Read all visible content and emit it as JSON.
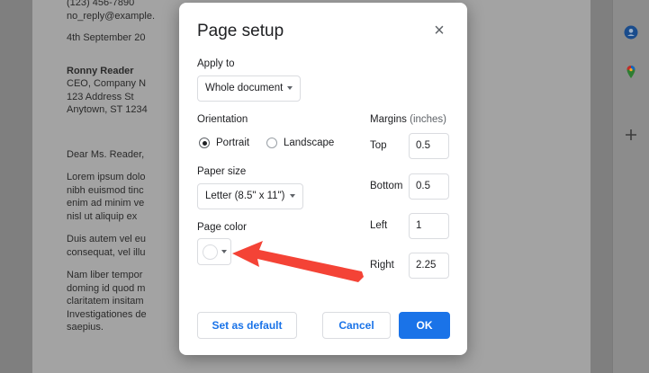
{
  "document": {
    "lines_top": [
      "(123) 456-7890",
      "no_reply@example."
    ],
    "date": "4th September 20",
    "recipient": [
      "Ronny Reader",
      "CEO, Company N",
      "123 Address St",
      "Anytown, ST 1234"
    ],
    "greeting": "Dear Ms. Reader,",
    "para1": [
      "Lorem ipsum dolo",
      "nibh euismod tinc",
      "enim ad minim ve",
      "nisl ut aliquip ex"
    ],
    "para2": [
      "Duis autem vel eu",
      "consequat, vel illu"
    ],
    "para3": [
      "Nam liber tempor",
      "doming id quod m",
      "claritatem insitam",
      "Investigationes de",
      "saepius."
    ]
  },
  "right_rail": {
    "icons": [
      "contacts-icon",
      "maps-icon",
      "add-icon"
    ],
    "colors": {
      "contacts": "#1a73e8",
      "add": "#3c4043"
    }
  },
  "dialog": {
    "title": "Page setup",
    "apply_to": {
      "label": "Apply to",
      "value": "Whole document"
    },
    "orientation": {
      "label": "Orientation",
      "options": [
        "Portrait",
        "Landscape"
      ],
      "selected": "Portrait"
    },
    "paper_size": {
      "label": "Paper size",
      "value": "Letter (8.5\" x 11\")"
    },
    "page_color": {
      "label": "Page color",
      "value": "#ffffff"
    },
    "margins": {
      "label": "Margins",
      "unit": "(inches)",
      "top": {
        "label": "Top",
        "value": "0.5"
      },
      "bottom": {
        "label": "Bottom",
        "value": "0.5"
      },
      "left": {
        "label": "Left",
        "value": "1"
      },
      "right": {
        "label": "Right",
        "value": "2.25"
      }
    },
    "buttons": {
      "default": "Set as default",
      "cancel": "Cancel",
      "ok": "OK"
    },
    "colors": {
      "primary": "#1a73e8",
      "annotation_arrow": "#f44336"
    }
  }
}
